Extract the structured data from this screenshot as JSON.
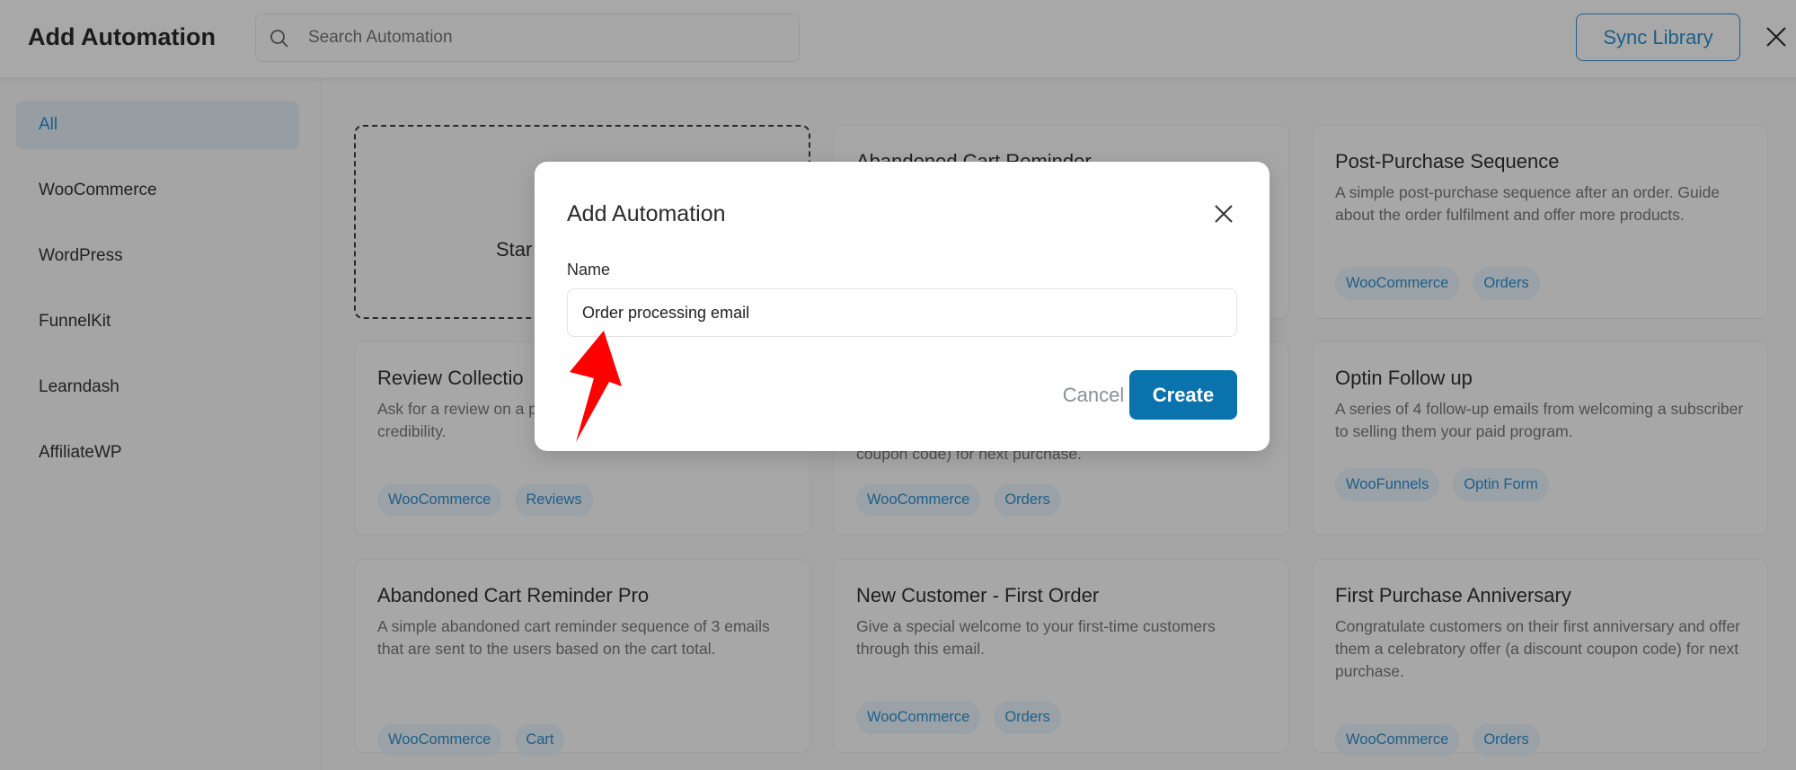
{
  "header": {
    "title": "Add Automation",
    "search_placeholder": "Search Automation",
    "sync_label": "Sync Library"
  },
  "sidebar": {
    "items": [
      {
        "label": "All",
        "active": true
      },
      {
        "label": "WooCommerce"
      },
      {
        "label": "WordPress"
      },
      {
        "label": "FunnelKit"
      },
      {
        "label": "Learndash"
      },
      {
        "label": "AffiliateWP"
      }
    ]
  },
  "cards": {
    "start": {
      "label": "Star"
    },
    "items": [
      {
        "title": "Abandoned Cart Reminder",
        "desc": "",
        "tags": []
      },
      {
        "title": "Post-Purchase Sequence",
        "desc": "A simple post-purchase sequence after an order. Guide about the order fulfilment and offer more products.",
        "tags": [
          "WooCommerce",
          "Orders"
        ]
      },
      {
        "title": "Review Collectio",
        "desc": "Ask for a review on a period ago using this boost brand credibility.",
        "tags": [
          "WooCommerce",
          "Reviews"
        ]
      },
      {
        "title": "",
        "desc": "coupon code) for next purchase.",
        "tags": [
          "WooCommerce",
          "Orders"
        ]
      },
      {
        "title": "Optin Follow up",
        "desc": "A series of 4 follow-up emails from welcoming a subscriber to selling them your paid program.",
        "tags": [
          "WooFunnels",
          "Optin Form"
        ]
      },
      {
        "title": "Abandoned Cart Reminder Pro",
        "desc": "A simple abandoned cart reminder sequence of 3 emails that are sent to the users based on the cart total.",
        "tags": [
          "WooCommerce",
          "Cart"
        ]
      },
      {
        "title": "New Customer - First Order",
        "desc": "Give a special welcome to your first-time customers through this email.",
        "tags": [
          "WooCommerce",
          "Orders"
        ]
      },
      {
        "title": "First Purchase Anniversary",
        "desc": "Congratulate customers on their first anniversary and offer them a celebratory offer (a discount coupon code) for next purchase.",
        "tags": [
          "WooCommerce",
          "Orders"
        ]
      }
    ]
  },
  "modal": {
    "title": "Add Automation",
    "name_label": "Name",
    "name_value": "Order processing email",
    "cancel_label": "Cancel",
    "create_label": "Create"
  },
  "colors": {
    "accent": "#0a72ac",
    "annotation_arrow": "#ff0000",
    "tag_text": "#1e5e8a"
  },
  "icons": {
    "search": "search-icon",
    "close": "close-icon",
    "annotation": "red-arrow-icon"
  }
}
